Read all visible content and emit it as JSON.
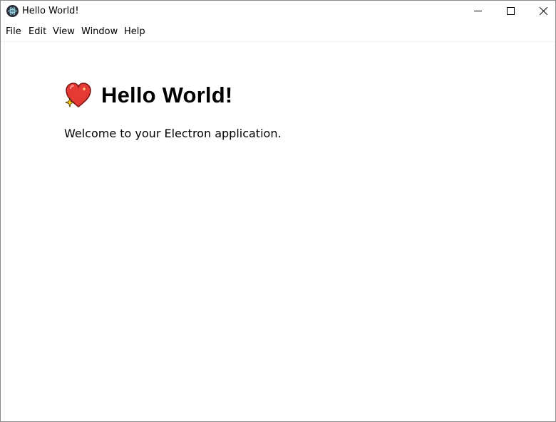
{
  "window": {
    "title": "Hello World!",
    "app_icon": "electron-logo-icon"
  },
  "controls": {
    "minimize_icon": "minimize-icon",
    "maximize_icon": "maximize-icon",
    "close_icon": "close-icon"
  },
  "menu": {
    "items": [
      {
        "label": "File"
      },
      {
        "label": "Edit"
      },
      {
        "label": "View"
      },
      {
        "label": "Window"
      },
      {
        "label": "Help"
      }
    ]
  },
  "main": {
    "heading_icon": "sparkling-heart-icon",
    "heading": "Hello World!",
    "welcome": "Welcome to your Electron application."
  },
  "colors": {
    "heart": "#e53935",
    "sparkle": "#ffc107",
    "app_icon_bg": "#2b2e3b",
    "app_icon_fg": "#9feaf9"
  }
}
